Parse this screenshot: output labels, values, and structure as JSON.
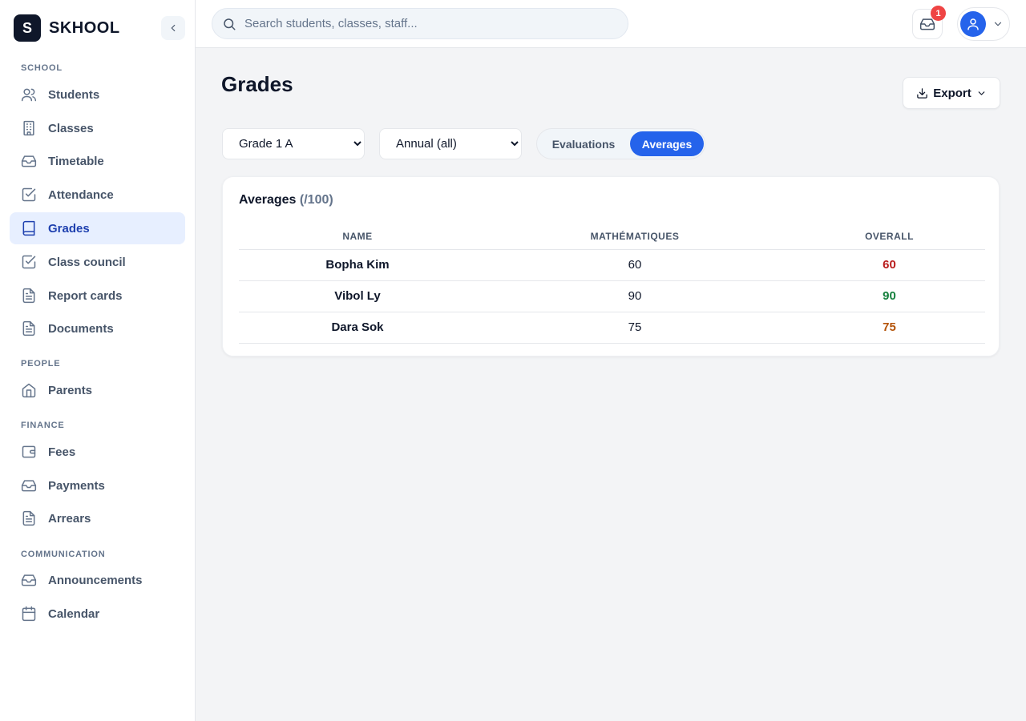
{
  "brand": {
    "logo_letter": "S",
    "name": "SKHOOL"
  },
  "sidebar": {
    "sections": [
      {
        "label": "SCHOOL"
      },
      {
        "label": "PEOPLE"
      },
      {
        "label": "FINANCE"
      },
      {
        "label": "COMMUNICATION"
      }
    ],
    "items": [
      {
        "label": "Students",
        "icon": "users-icon"
      },
      {
        "label": "Classes",
        "icon": "building-icon"
      },
      {
        "label": "Timetable",
        "icon": "inbox-icon"
      },
      {
        "label": "Attendance",
        "icon": "checkbox-icon"
      },
      {
        "label": "Grades",
        "icon": "book-icon",
        "active": true
      },
      {
        "label": "Class council",
        "icon": "checkbox-icon"
      },
      {
        "label": "Report cards",
        "icon": "document-icon"
      },
      {
        "label": "Documents",
        "icon": "document-icon"
      },
      {
        "label": "Parents",
        "icon": "home-icon"
      },
      {
        "label": "Fees",
        "icon": "wallet-icon"
      },
      {
        "label": "Payments",
        "icon": "inbox-icon"
      },
      {
        "label": "Arrears",
        "icon": "document-icon"
      },
      {
        "label": "Announcements",
        "icon": "inbox-icon"
      },
      {
        "label": "Calendar",
        "icon": "calendar-icon"
      }
    ]
  },
  "topbar": {
    "search_placeholder": "Search students, classes, staff...",
    "notification_count": "1"
  },
  "page": {
    "title": "Grades",
    "export_label": "Export"
  },
  "filters": {
    "class_options": [
      "Grade 1 A"
    ],
    "period_options": [
      "Annual (all)"
    ],
    "view_tabs": [
      "Evaluations",
      "Averages"
    ],
    "active_tab": "Averages"
  },
  "card": {
    "title": "Averages",
    "title_suffix": "(/100)",
    "columns": [
      "NAME",
      "MATHÉMATIQUES",
      "OVERALL"
    ],
    "rows": [
      {
        "name": "Bopha Kim",
        "math": "60",
        "overall": "60",
        "overall_color": "#b91c1c"
      },
      {
        "name": "Vibol Ly",
        "math": "90",
        "overall": "90",
        "overall_color": "#15803d"
      },
      {
        "name": "Dara Sok",
        "math": "75",
        "overall": "75",
        "overall_color": "#b45309"
      }
    ]
  },
  "colors": {
    "accent": "#2563eb",
    "active_nav_bg": "#e7efff",
    "badge": "#ef4444"
  }
}
